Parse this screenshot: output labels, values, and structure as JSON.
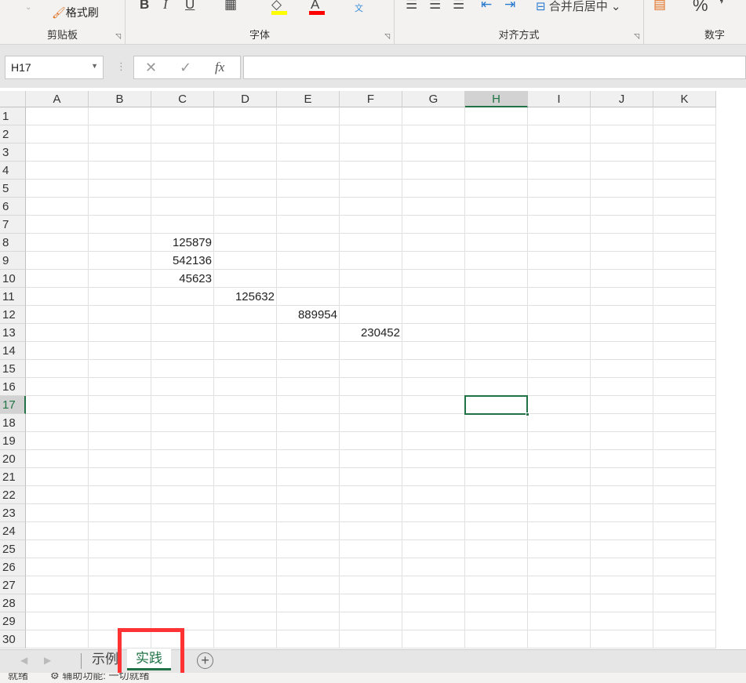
{
  "ribbon": {
    "clipboard": {
      "format_painter": "格式刷",
      "label": "剪贴板"
    },
    "font": {
      "bold": "B",
      "italic": "I",
      "underline": "U",
      "font_color": "A",
      "label": "字体",
      "fill_color": "#ffff00",
      "text_color": "#ff0000"
    },
    "alignment": {
      "merge_center": "合并后居中",
      "label": "对齐方式"
    },
    "number": {
      "percent": "%",
      "comma": "❜",
      "label": "数字"
    }
  },
  "formula_bar": {
    "name_box": "H17",
    "fx": "fx",
    "cancel": "✕",
    "enter": "✓",
    "value": ""
  },
  "columns": [
    "A",
    "B",
    "C",
    "D",
    "E",
    "F",
    "G",
    "H",
    "I",
    "J",
    "K"
  ],
  "rows": [
    "1",
    "2",
    "3",
    "4",
    "5",
    "6",
    "7",
    "8",
    "9",
    "10",
    "11",
    "12",
    "13",
    "14",
    "15",
    "16",
    "17",
    "18",
    "19",
    "20",
    "21",
    "22",
    "23",
    "24",
    "25",
    "26",
    "27",
    "28",
    "29",
    "30"
  ],
  "cells": [
    {
      "ref": "C8",
      "value": "125879"
    },
    {
      "ref": "C9",
      "value": "542136"
    },
    {
      "ref": "C10",
      "value": "45623"
    },
    {
      "ref": "D11",
      "value": "125632"
    },
    {
      "ref": "E12",
      "value": "889954"
    },
    {
      "ref": "F13",
      "value": "230452"
    }
  ],
  "selected_cell": "H17",
  "sheets": [
    {
      "name": "示例",
      "active": false
    },
    {
      "name": "实践",
      "active": true
    }
  ],
  "status": {
    "ready": "就绪",
    "accessibility": "辅助功能: 一切就绪"
  },
  "accent": "#217346",
  "highlight_box_color": "#ff3333"
}
